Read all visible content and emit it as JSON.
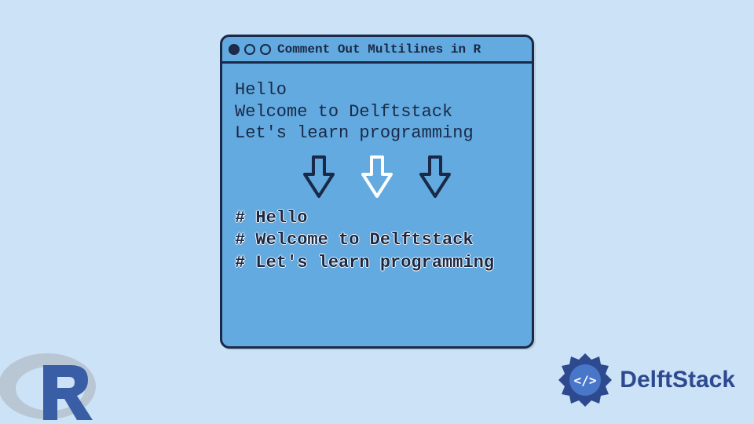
{
  "window": {
    "title": "Comment Out Multilines in R"
  },
  "beforeLines": [
    "Hello",
    "Welcome to Delftstack",
    "Let's learn programming"
  ],
  "afterLines": [
    "# Hello",
    "# Welcome to Delftstack",
    "# Let's learn programming"
  ],
  "brandText": "DelftStack"
}
